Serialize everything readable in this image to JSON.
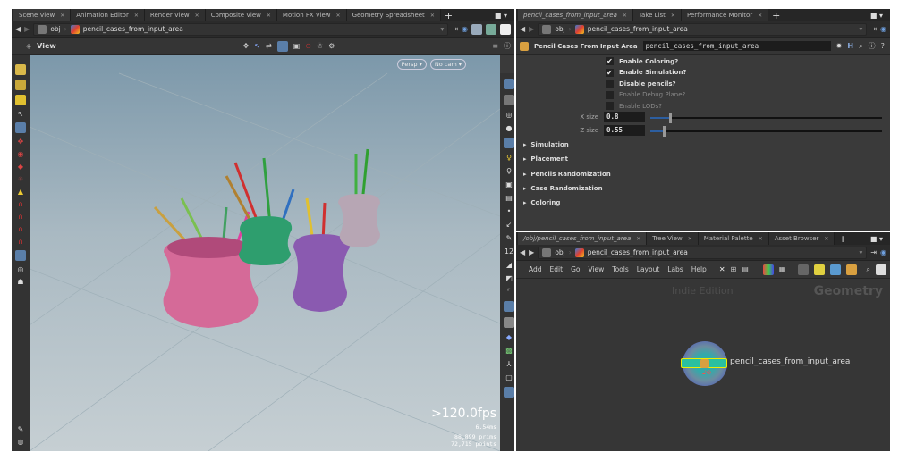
{
  "left_pane": {
    "tabs": [
      {
        "label": "Scene View"
      },
      {
        "label": "Animation Editor"
      },
      {
        "label": "Render View"
      },
      {
        "label": "Composite View"
      },
      {
        "label": "Motion FX View"
      },
      {
        "label": "Geometry Spreadsheet"
      }
    ],
    "path": {
      "root": "obj",
      "node": "pencil_cases_from_input_area"
    },
    "viewer_label": "View",
    "persp_button": "Persp ▾",
    "cam_button": "No cam ▾",
    "stats": {
      "fps": ">120.0fps",
      "ms": "6.54ms",
      "prims": "88,899  prims",
      "points": "72,715 points"
    }
  },
  "param_pane": {
    "tabs": [
      {
        "label": "pencil_cases_from_input_area"
      },
      {
        "label": "Take List"
      },
      {
        "label": "Performance Monitor"
      }
    ],
    "path": {
      "root": "obj",
      "node": "pencil_cases_from_input_area"
    },
    "node_type": "Pencil Cases From Input Area",
    "node_name": "pencil_cases_from_input_area",
    "toggles": [
      {
        "label": "Enable Coloring?",
        "checked": true,
        "enabled": true
      },
      {
        "label": "Enable Simulation?",
        "checked": true,
        "enabled": true
      },
      {
        "label": "Disable pencils?",
        "checked": false,
        "enabled": true
      },
      {
        "label": "Enable Debug Plane?",
        "checked": false,
        "enabled": false
      },
      {
        "label": "Enable LODs?",
        "checked": false,
        "enabled": false
      }
    ],
    "x_size": {
      "label": "X size",
      "value": "0.8",
      "fraction": 0.08
    },
    "z_size": {
      "label": "Z size",
      "value": "0.55",
      "fraction": 0.055
    },
    "folders": [
      "Simulation",
      "Placement",
      "Pencils Randomization",
      "Case Randomization",
      "Coloring"
    ],
    "check_glyph": "✔"
  },
  "network_pane": {
    "tabs": [
      {
        "label": "/obj/pencil_cases_from_input_area"
      },
      {
        "label": "Tree View"
      },
      {
        "label": "Material Palette"
      },
      {
        "label": "Asset Browser"
      }
    ],
    "path": {
      "root": "obj",
      "node": "pencil_cases_from_input_area"
    },
    "menu": [
      "Add",
      "Edit",
      "Go",
      "View",
      "Tools",
      "Layout",
      "Labs",
      "Help"
    ],
    "watermark": "Indie Edition",
    "context": "Geometry",
    "node_label": "pencil_cases_from_input_area"
  }
}
